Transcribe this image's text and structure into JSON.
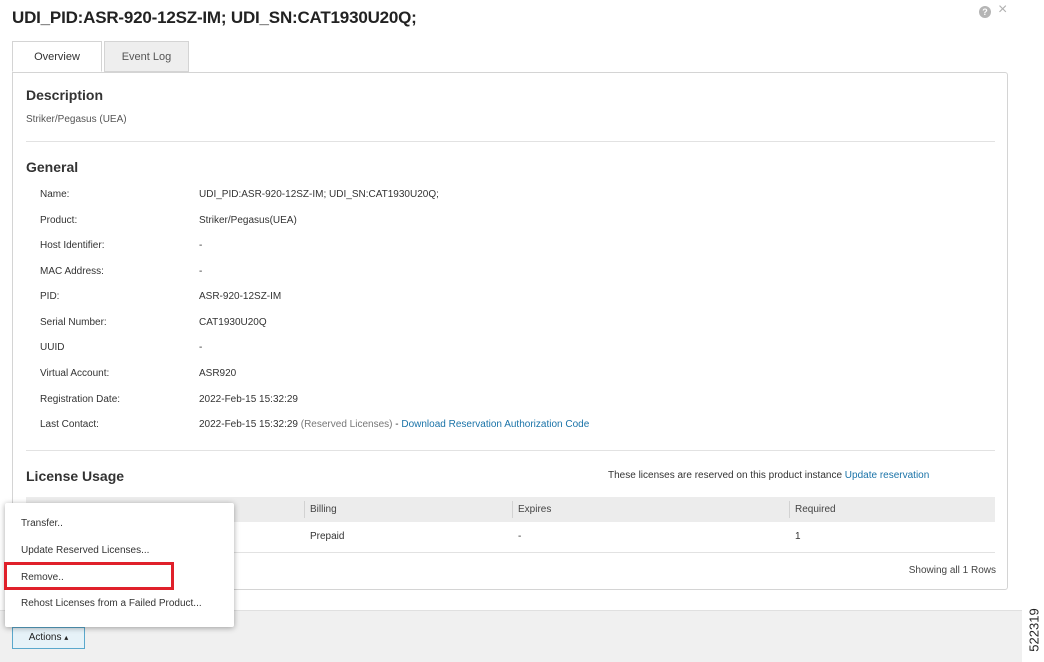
{
  "header": {
    "title": "UDI_PID:ASR-920-12SZ-IM; UDI_SN:CAT1930U20Q;",
    "help_glyph": "?",
    "close_glyph": "×"
  },
  "tabs": [
    {
      "label": "Overview",
      "active": true
    },
    {
      "label": "Event Log",
      "active": false
    }
  ],
  "description": {
    "heading": "Description",
    "text": "Striker/Pegasus (UEA)"
  },
  "general": {
    "heading": "General",
    "fields": [
      {
        "label": "Name:",
        "value": "UDI_PID:ASR-920-12SZ-IM; UDI_SN:CAT1930U20Q;"
      },
      {
        "label": "Product:",
        "value": "Striker/Pegasus(UEA)"
      },
      {
        "label": "Host Identifier:",
        "value": "-"
      },
      {
        "label": "MAC Address:",
        "value": "-"
      },
      {
        "label": "PID:",
        "value": "ASR-920-12SZ-IM"
      },
      {
        "label": "Serial Number:",
        "value": "CAT1930U20Q"
      },
      {
        "label": "UUID",
        "value": "-"
      },
      {
        "label": "Virtual Account:",
        "value": "ASR920"
      },
      {
        "label": "Registration Date:",
        "value": "2022-Feb-15 15:32:29"
      },
      {
        "label": "Last Contact:",
        "value": "2022-Feb-15 15:32:29"
      }
    ],
    "last_contact_note": "(Reserved Licenses)",
    "last_contact_sep": " - ",
    "download_link": "Download Reservation Authorization Code"
  },
  "license_usage": {
    "heading": "License Usage",
    "note": "These licenses are reserved on this product instance",
    "update_link": "Update reservation",
    "columns": [
      "Billing",
      "Expires",
      "Required"
    ],
    "rows": [
      {
        "billing": "Prepaid",
        "expires": "-",
        "required": "1"
      }
    ],
    "showing": "Showing all 1 Rows"
  },
  "actions": {
    "button_label": "Actions",
    "caret": "▴",
    "menu": [
      "Transfer..",
      "Update Reserved Licenses...",
      "Remove..",
      "Rehost Licenses from a Failed Product..."
    ]
  },
  "figure_id": "522319",
  "colors": {
    "link": "#1a73a8",
    "highlight": "#e0202a"
  }
}
